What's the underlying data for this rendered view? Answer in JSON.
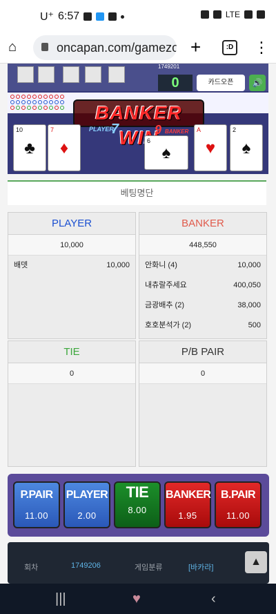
{
  "statusbar": {
    "carrier": "U⁺",
    "time": "6:57",
    "network": "LTE"
  },
  "browser": {
    "url": "oncapan.com/gamezo"
  },
  "game": {
    "round": "1749201",
    "counter": "0",
    "open_button": "카드오픈",
    "banner": "BANKER WIN",
    "player_tag": "PLAYER",
    "player_score": "7",
    "banker_tag": "BANKER",
    "banker_score": "9",
    "player_cards": [
      {
        "rank": "10",
        "suit": "♣",
        "color": "black"
      },
      {
        "rank": "7",
        "suit": "♦",
        "color": "red"
      }
    ],
    "banker_cards": [
      {
        "rank": "6",
        "suit": "♠",
        "color": "black"
      },
      {
        "rank": "A",
        "suit": "♥",
        "color": "red"
      },
      {
        "rank": "2",
        "suit": "♠",
        "color": "black"
      }
    ]
  },
  "betlist": {
    "header": "베팅명단",
    "player": {
      "title": "PLAYER",
      "total": "10,000",
      "rows": [
        {
          "name": "배뎃",
          "amount": "10,000"
        }
      ]
    },
    "banker": {
      "title": "BANKER",
      "total": "448,550",
      "rows": [
        {
          "name": "안화니 (4)",
          "amount": "10,000"
        },
        {
          "name": "내츄랄주세요",
          "amount": "400,050"
        },
        {
          "name": "금광배추 (2)",
          "amount": "38,000"
        },
        {
          "name": "호호분석가 (2)",
          "amount": "500"
        }
      ]
    },
    "tie": {
      "title": "TIE",
      "total": "0"
    },
    "pair": {
      "title": "P/B PAIR",
      "total": "0"
    }
  },
  "bets": [
    {
      "label": "P.PAIR",
      "odds": "11.00",
      "color": "#3a6fce"
    },
    {
      "label": "PLAYER",
      "odds": "2.00",
      "color": "#3a6fce"
    },
    {
      "label": "TIE",
      "odds": "8.00",
      "color": "#137a22"
    },
    {
      "label": "BANKER",
      "odds": "1.95",
      "color": "#c81a1a"
    },
    {
      "label": "B.PAIR",
      "odds": "11.00",
      "color": "#c81a1a"
    }
  ],
  "info": {
    "round_label": "회차",
    "round_value": "1749206",
    "category_label": "게임분류",
    "category_value": "[바카라]"
  },
  "colors": {
    "player_accent": "#1a4fd1",
    "banker_accent": "#e05a4b",
    "tie_accent": "#3aa63a"
  }
}
